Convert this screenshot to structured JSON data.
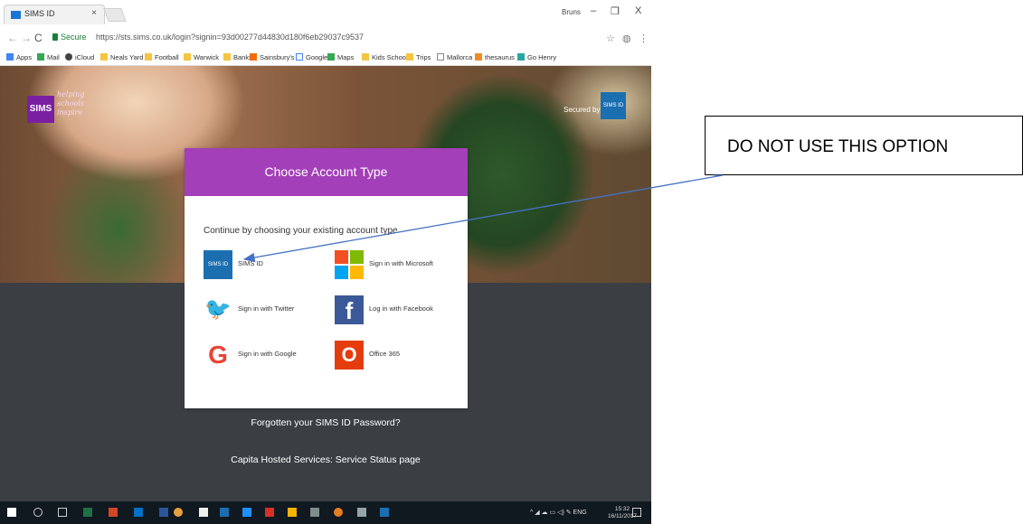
{
  "browser": {
    "tab_title": "SIMS ID",
    "tab_close": "×",
    "user_name": "Bruns",
    "window_controls": [
      "–",
      "❐",
      "X"
    ],
    "nav_icons": [
      "back-icon",
      "forward-icon",
      "reload-icon"
    ],
    "security_label": "Secure",
    "url": "https://sts.sims.co.uk/login?signin=93d00277d44830d180f6eb29037c9537",
    "bookmarks": [
      "Apps",
      "Mail",
      "iCloud",
      "Neals Yard",
      "Football",
      "Warwick",
      "Banks",
      "Sainsbury's",
      "Google",
      "Maps",
      "Kids School",
      "Trips",
      "Mallorca",
      "thesaurus",
      "Go Henry"
    ]
  },
  "header": {
    "logo_text": "SIMS",
    "tagline": [
      "helping",
      "schools",
      "inspire"
    ],
    "secured_by": "Secured by",
    "secured_badge": "SIMS ID"
  },
  "card": {
    "title": "Choose Account Type",
    "intro": "Continue by choosing your existing account type",
    "options": [
      {
        "label": "SIMS ID",
        "icon": "sims-id-icon",
        "icon_text": "SIMS ID",
        "color": "#1b6fb0"
      },
      {
        "label": "Sign in with Microsoft",
        "icon": "microsoft-icon"
      },
      {
        "label": "Sign in with Twitter",
        "icon": "twitter-icon",
        "color": "#1da1f2"
      },
      {
        "label": "Log in with Facebook",
        "icon": "facebook-icon",
        "color": "#3b5998"
      },
      {
        "label": "Sign in with Google",
        "icon": "google-icon"
      },
      {
        "label": "Office 365",
        "icon": "office-365-icon",
        "color": "#e43c0c"
      }
    ]
  },
  "links": {
    "forgot": "Forgotten your SIMS ID Password?",
    "status": "Capita Hosted Services: Service Status page"
  },
  "taskbar": {
    "tray_lang": "ENG",
    "time": "15:32",
    "date": "16/11/2017"
  },
  "annotation": {
    "text": "DO NOT USE THIS OPTION"
  },
  "colors": {
    "accent_purple": "#a33fb8",
    "page_dark": "#3b3f44",
    "sims_blue": "#1b6fb0"
  }
}
